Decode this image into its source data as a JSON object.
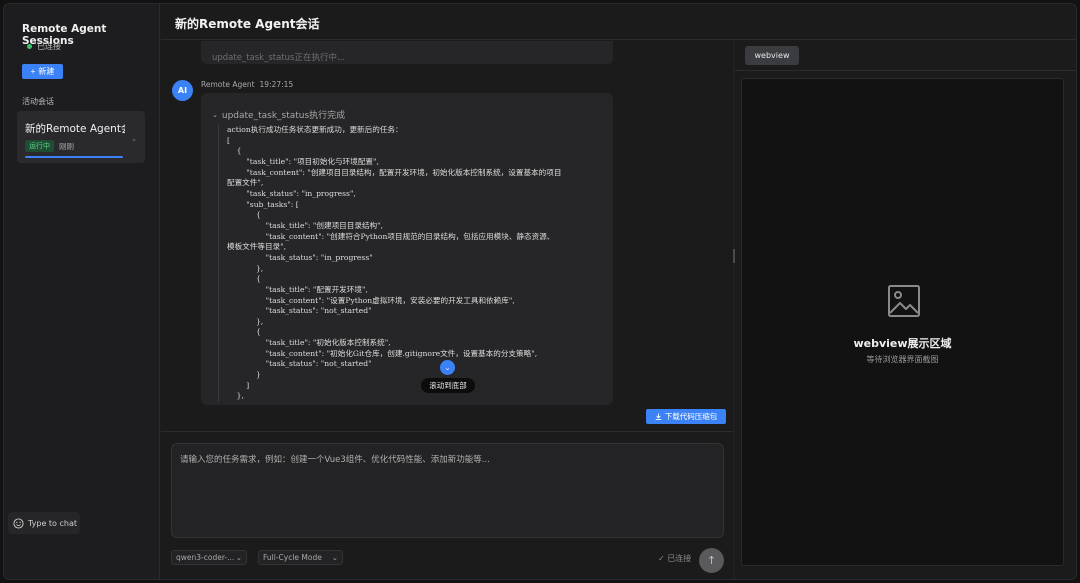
{
  "sidebar": {
    "title": "Remote Agent Sessions",
    "status": "已连接",
    "new_button": "新建",
    "section_label": "活动会话",
    "session": {
      "name": "新的Remote Agent会话",
      "badge": "运行中",
      "time": "刚刚"
    },
    "chat_toggle": "Type to chat"
  },
  "header": {
    "title": "新的Remote Agent会话"
  },
  "chat": {
    "prev_message": "update_task_status正在执行中...",
    "avatar": "AI",
    "sender": "Remote Agent",
    "timestamp": "19:27:15",
    "tool_summary": "update_task_status执行完成",
    "code": "action执行成功任务状态更新成功，更新后的任务：\n[\n    {\n        \"task_title\": \"项目初始化与环境配置\",\n        \"task_content\": \"创建项目目录结构，配置开发环境，初始化版本控制系统，设置基本的项目\n配置文件\",\n        \"task_status\": \"in_progress\",\n        \"sub_tasks\": [\n            {\n                \"task_title\": \"创建项目目录结构\",\n                \"task_content\": \"创建符合Python项目规范的目录结构，包括应用模块、静态资源、\n模板文件等目录\",\n                \"task_status\": \"in_progress\"\n            },\n            {\n                \"task_title\": \"配置开发环境\",\n                \"task_content\": \"设置Python虚拟环境，安装必要的开发工具和依赖库\",\n                \"task_status\": \"not_started\"\n            },\n            {\n                \"task_title\": \"初始化版本控制系统\",\n                \"task_content\": \"初始化Git仓库，创建.gitignore文件，设置基本的分支策略\",\n                \"task_status\": \"not_started\"\n            }\n        ]\n    },",
    "scroll_bottom": "滚动到底部",
    "download_button": "下载代码压缩包"
  },
  "input": {
    "placeholder": "请输入您的任务需求，例如：创建一个Vue3组件、优化代码性能、添加新功能等...",
    "model_select": "qwen3-coder-...",
    "mode_select": "Full-Cycle Mode",
    "connection": "已连接"
  },
  "webview": {
    "tab": "webview",
    "title": "webview展示区域",
    "subtitle": "等待浏览器界面截图"
  },
  "colors": {
    "accent": "#3b82f6",
    "success": "#3ec46d",
    "background": "#1b1b1c"
  },
  "icons": {
    "plus": "plus-icon",
    "chevron": "chevron-down-icon",
    "send": "arrow-up-icon",
    "image": "image-placeholder-icon",
    "download": "download-icon",
    "chat": "smile-icon"
  }
}
